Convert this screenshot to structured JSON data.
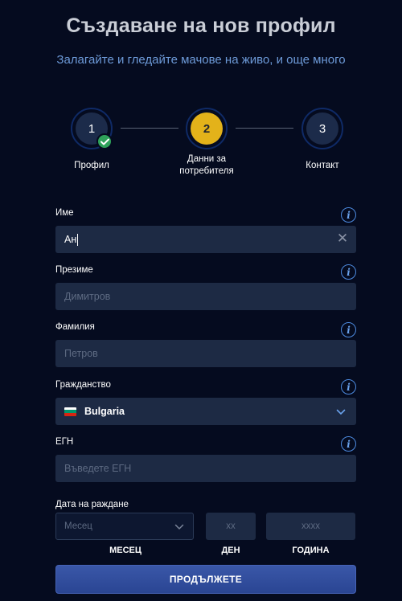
{
  "header": {
    "title": "Създаване на нов профил",
    "subtitle": "Залагайте и гледайте мачове на живо, и още много"
  },
  "stepper": {
    "steps": [
      {
        "number": "1",
        "label": "Профил",
        "state": "completed"
      },
      {
        "number": "2",
        "label_line1": "Данни за",
        "label_line2": "потребителя",
        "state": "active"
      },
      {
        "number": "3",
        "label": "Контакт",
        "state": "pending"
      }
    ]
  },
  "form": {
    "first_name": {
      "label": "Име",
      "value": "Ан"
    },
    "middle_name": {
      "label": "Презиме",
      "placeholder": "Димитров"
    },
    "last_name": {
      "label": "Фамилия",
      "placeholder": "Петров"
    },
    "citizenship": {
      "label": "Гражданство",
      "value": "Bulgaria"
    },
    "egn": {
      "label": "ЕГН",
      "placeholder": "Въведете ЕГН"
    },
    "birth_date": {
      "label": "Дата на раждане",
      "month": {
        "placeholder": "Месец",
        "caption": "МЕСЕЦ"
      },
      "day": {
        "placeholder": "xx",
        "caption": "ДЕН"
      },
      "year": {
        "placeholder": "xxxx",
        "caption": "ГОДИНА"
      }
    },
    "info_glyph": "i",
    "clear_glyph": "✕"
  },
  "actions": {
    "continue_label": "ПРОДЪЛЖЕТЕ"
  },
  "colors": {
    "background": "#050b1f",
    "accent_active_step": "#e3b21a",
    "completed_check": "#2fa25a",
    "input_bg": "#1d2a44",
    "button": "#2a4593"
  },
  "icons": {
    "completed": "check-icon",
    "info": "info-icon",
    "clear": "close-icon",
    "dropdown": "chevron-down-icon",
    "flag": "flag-bulgaria-icon"
  }
}
